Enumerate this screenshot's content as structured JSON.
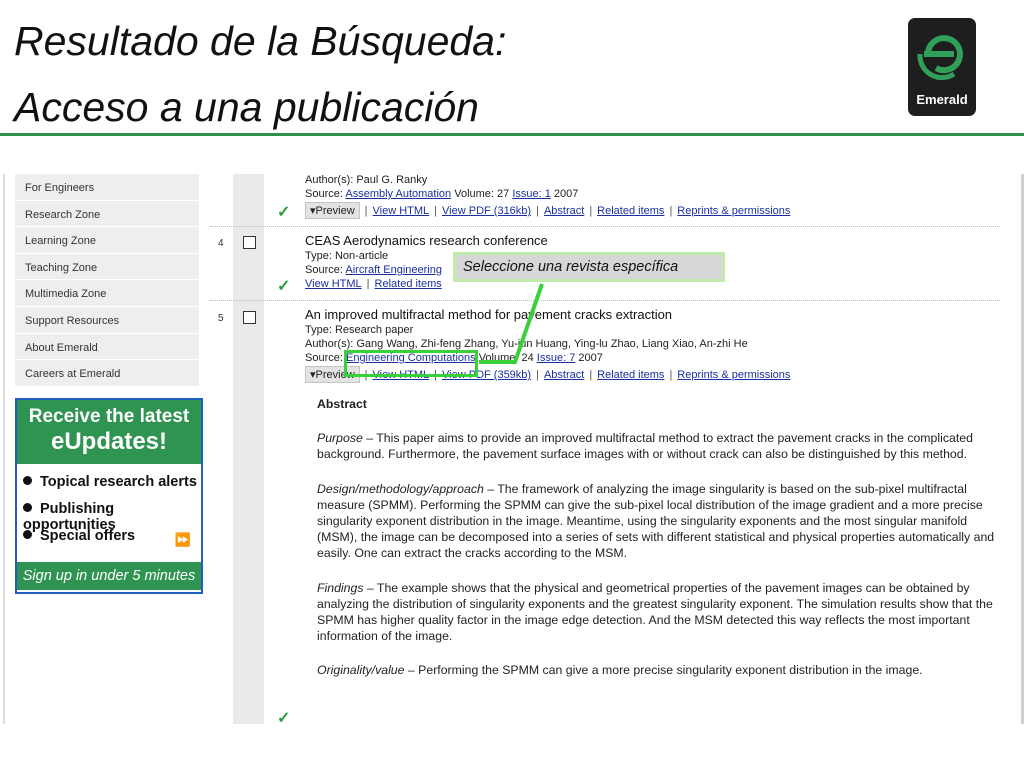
{
  "slide": {
    "title_line1": "Resultado de la Búsqueda:",
    "title_line2": "Acceso a una publicación",
    "logo_text": "Emerald",
    "callout": "Seleccione una revista específica"
  },
  "sidebar": {
    "items": [
      "For Engineers",
      "Research Zone",
      "Learning Zone",
      "Teaching Zone",
      "Multimedia Zone",
      "Support Resources",
      "About Emerald",
      "Careers at Emerald"
    ]
  },
  "promo": {
    "line1": "Receive the latest",
    "line2": "eUpdates!",
    "bullets": [
      "Topical research alerts",
      "Publishing opportunities",
      "Special offers"
    ],
    "arrow": "⏩",
    "footer": "Sign up in under 5 minutes"
  },
  "results": {
    "r3": {
      "authors": "Author(s): Paul G. Ranky",
      "source_label": "Source:",
      "source_link": "Assembly Automation",
      "volume": "Volume: 27",
      "issue_link": "Issue: 1",
      "year": "2007",
      "preview": "▾Preview",
      "links": [
        "View HTML",
        "View PDF (316kb)",
        "Abstract",
        "Related items",
        "Reprints & permissions"
      ]
    },
    "r4": {
      "number": "4",
      "title": "CEAS Aerodynamics research conference",
      "type": "Type: Non-article",
      "source_label": "Source:",
      "source_link": "Aircraft Engineering",
      "links": [
        "View HTML",
        "Related items"
      ]
    },
    "r5": {
      "number": "5",
      "title": "An improved multifractal method for pavement cracks extraction",
      "type": "Type: Research paper",
      "authors": "Author(s): Gang Wang, Zhi-feng Zhang, Yu-jun Huang, Ying-lu Zhao, Liang Xiao, An-zhi He",
      "source_label": "Source:",
      "source_link": "Engineering Computations",
      "volume": "Volume: 24",
      "issue_link": "Issue: 7",
      "year": "2007",
      "preview": "▾Preview",
      "links": [
        "View HTML",
        "View PDF (359kb)",
        "Abstract",
        "Related items",
        "Reprints & permissions"
      ]
    }
  },
  "abstract": {
    "heading": "Abstract",
    "purpose_label": "Purpose",
    "purpose": " – This paper aims to provide an improved multifractal method to extract the pavement cracks in the complicated background. Furthermore, the pavement surface images with or without crack can also be distinguished by this method.",
    "design_label": "Design/methodology/approach",
    "design": " – The framework of analyzing the image singularity is based on the sub-pixel multifractal measure (SPMM). Performing the SPMM can give the sub-pixel local distribution of the image gradient and a more precise singularity exponent distribution in the image. Meantime, using the singularity exponents and the most singular manifold (MSM), the image can be decomposed into a series of sets with different statistical and physical properties automatically and easily. One can extract the cracks according to the MSM.",
    "findings_label": "Findings",
    "findings": " – The example shows that the physical and geometrical properties of the pavement images can be obtained by analyzing the distribution of singularity exponents and the greatest singularity exponent. The simulation results show that the SPMM has higher quality factor in the image edge detection. And the MSM detected this way reflects the most important information of the image.",
    "originality_label": "Originality/value",
    "originality": " – Performing the SPMM can give a more precise singularity exponent distribution in the image."
  },
  "colors": {
    "accent": "#2f8f4f",
    "link": "#1a2fa0",
    "highlight": "#39d13a"
  }
}
